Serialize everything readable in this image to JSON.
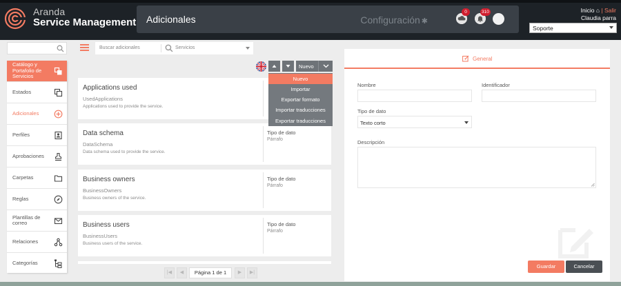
{
  "header": {
    "brand_line1": "Aranda",
    "brand_line2": "Service Management",
    "section_title": "Adicionales",
    "config_label": "Configuración",
    "cloud_badge": "0",
    "bell_badge": "310",
    "inicio_label": "Inicio",
    "separator": "|",
    "salir_label": "Salir",
    "user_name": "Claudia parra",
    "role_value": "Soporte"
  },
  "sidebar": {
    "items": [
      {
        "label": "Catálogo y Portafolio de Servicios",
        "icon": "catalog-icon"
      },
      {
        "label": "Estados",
        "icon": "copy-icon"
      },
      {
        "label": "Adicionales",
        "icon": "plus-circle-icon"
      },
      {
        "label": "Perfiles",
        "icon": "profile-icon"
      },
      {
        "label": "Aprobaciones",
        "icon": "approval-icon"
      },
      {
        "label": "Carpetas",
        "icon": "folder-icon"
      },
      {
        "label": "Reglas",
        "icon": "compass-icon"
      },
      {
        "label": "Plantillas de correo",
        "icon": "mail-icon"
      },
      {
        "label": "Relaciones",
        "icon": "relations-icon"
      },
      {
        "label": "Categorías",
        "icon": "categories-icon"
      }
    ]
  },
  "toolbar": {
    "search_placeholder": "Buscar adicionales",
    "filter_value": "Servicios",
    "nuevo_label": "Nuevo"
  },
  "dropdown": {
    "items": [
      "Nuevo",
      "Importar",
      "Exportar formato",
      "Importar traducciones",
      "Exportar traducciones"
    ]
  },
  "cards": [
    {
      "title": "Applications used",
      "code": "UsedApplications",
      "desc": "Applications used to provide the service.",
      "type_label": "",
      "type_value": ""
    },
    {
      "title": "Data schema",
      "code": "DataSchema",
      "desc": "Data schema used to provide the service.",
      "type_label": "Tipo de dato",
      "type_value": "Párrafo"
    },
    {
      "title": "Business owners",
      "code": "BusinessOwners",
      "desc": "Business owners of the service.",
      "type_label": "Tipo de dato",
      "type_value": "Párrafo"
    },
    {
      "title": "Business users",
      "code": "BusinessUsers",
      "desc": "Business users of the service.",
      "type_label": "Tipo de dato",
      "type_value": "Párrafo"
    }
  ],
  "pager": {
    "label": "Página 1 de 1"
  },
  "form": {
    "tab_label": "General",
    "nombre_label": "Nombre",
    "identificador_label": "Identificador",
    "tipo_label": "Tipo de dato",
    "tipo_value": "Texto corto",
    "descripcion_label": "Descripción",
    "save_label": "Guardar",
    "cancel_label": "Cancelar"
  },
  "colors": {
    "accent": "#f37b62",
    "header_bg": "#1d2227",
    "dark_button": "#4a4f54"
  }
}
